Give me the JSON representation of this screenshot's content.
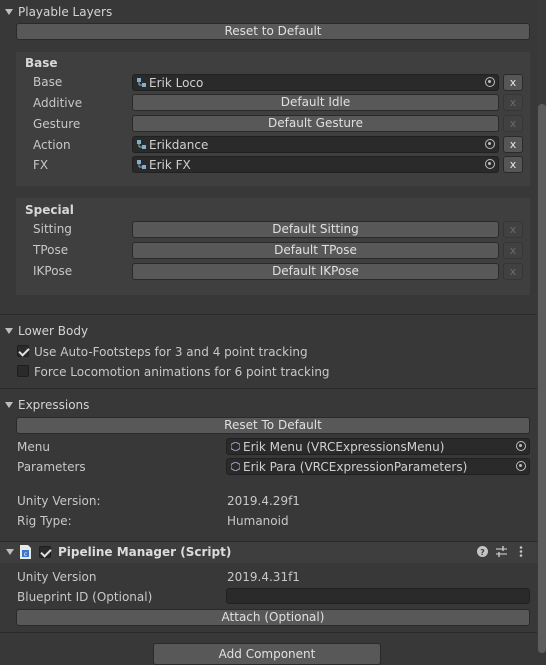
{
  "playable_layers": {
    "title": "Playable Layers",
    "reset_label": "Reset to Default",
    "base": {
      "header": "Base",
      "rows": [
        {
          "label": "Base",
          "kind": "field",
          "value": "Erik Loco",
          "x_enabled": true
        },
        {
          "label": "Additive",
          "kind": "button",
          "value": "Default Idle",
          "x_enabled": false
        },
        {
          "label": "Gesture",
          "kind": "button",
          "value": "Default Gesture",
          "x_enabled": false
        },
        {
          "label": "Action",
          "kind": "field",
          "value": "Erikdance",
          "x_enabled": true
        },
        {
          "label": "FX",
          "kind": "field",
          "value": "Erik FX",
          "x_enabled": true
        }
      ]
    },
    "special": {
      "header": "Special",
      "rows": [
        {
          "label": "Sitting",
          "kind": "button",
          "value": "Default Sitting",
          "x_enabled": false
        },
        {
          "label": "TPose",
          "kind": "button",
          "value": "Default TPose",
          "x_enabled": false
        },
        {
          "label": "IKPose",
          "kind": "button",
          "value": "Default IKPose",
          "x_enabled": false
        }
      ]
    },
    "x_label": "x"
  },
  "lower_body": {
    "title": "Lower Body",
    "options": [
      {
        "label": "Use Auto-Footsteps for 3 and 4 point tracking",
        "checked": true
      },
      {
        "label": "Force Locomotion animations for 6 point tracking",
        "checked": false
      }
    ]
  },
  "expressions": {
    "title": "Expressions",
    "reset_label": "Reset To Default",
    "menu_label": "Menu",
    "menu_value": "Erik Menu (VRCExpressionsMenu)",
    "parameters_label": "Parameters",
    "parameters_value": "Erik Para (VRCExpressionParameters)"
  },
  "info": {
    "unity_version_label": "Unity Version:",
    "unity_version_value": "2019.4.29f1",
    "rig_type_label": "Rig Type:",
    "rig_type_value": "Humanoid"
  },
  "pipeline_manager": {
    "title": "Pipeline Manager (Script)",
    "enabled": true,
    "unity_version_label": "Unity Version",
    "unity_version_value": "2019.4.31f1",
    "blueprint_label": "Blueprint ID (Optional)",
    "blueprint_value": "",
    "attach_label": "Attach (Optional)"
  },
  "add_component_label": "Add Component",
  "icons": {
    "help": "help-icon",
    "presets": "presets-sliders-icon",
    "more": "kebab-menu-icon",
    "script": "csharp-script-icon",
    "object_picker": "object-picker-icon",
    "animator": "animator-controller-icon",
    "expression_asset": "scriptable-object-icon"
  },
  "colors": {
    "background": "#383838",
    "panel": "#3f3f3f",
    "button": "#585858",
    "field": "#2a2a2a"
  }
}
